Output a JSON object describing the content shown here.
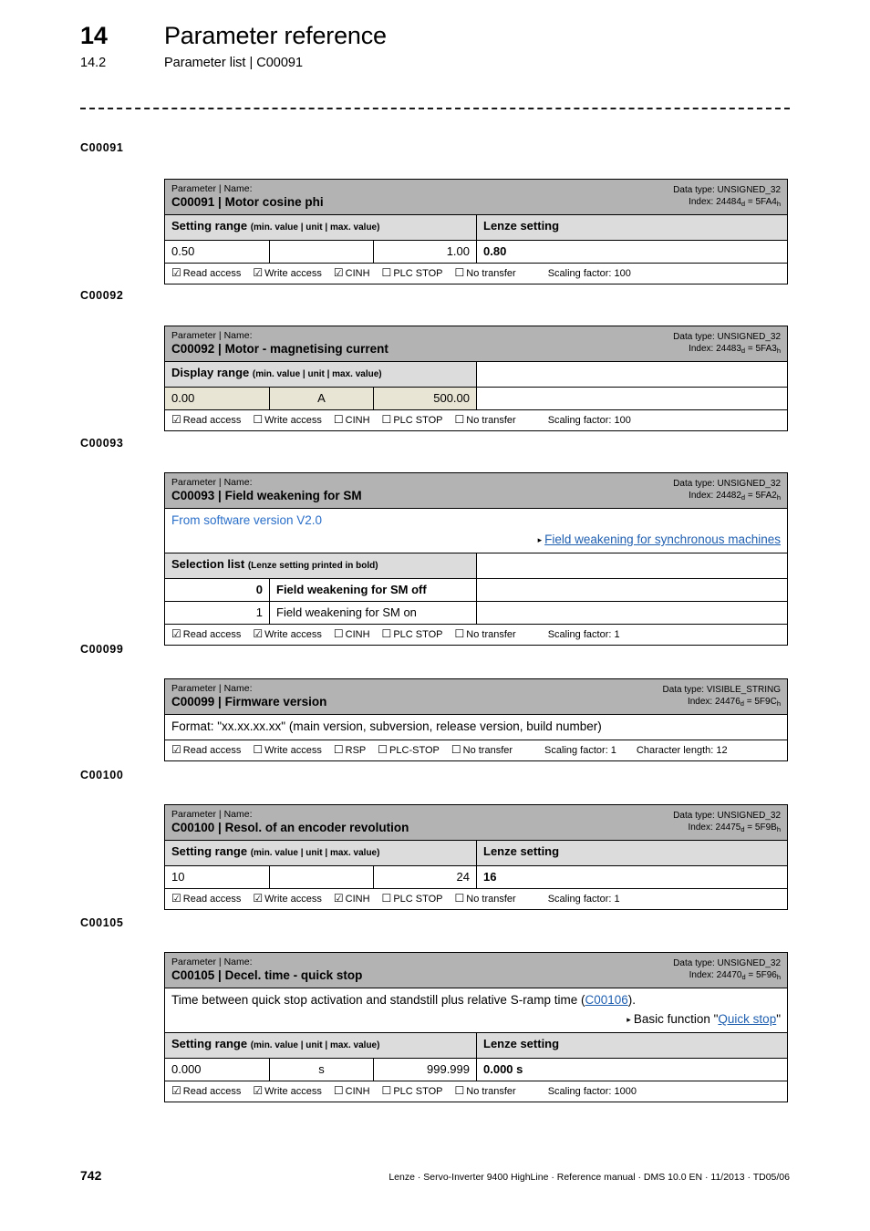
{
  "header": {
    "chapter_number": "14",
    "chapter_title": "Parameter reference",
    "section_number": "14.2",
    "section_title": "Parameter list | C00091"
  },
  "footer": {
    "page_number": "742",
    "text": "Lenze · Servo-Inverter 9400 HighLine · Reference manual · DMS 10.0 EN · 11/2013 · TD05/06"
  },
  "labels": {
    "param_name_caption": "Parameter | Name:",
    "setting_range": "Setting range",
    "display_range": "Display range",
    "range_paren": "(min. value | unit | max. value)",
    "selection_list": "Selection list",
    "selection_paren": "(Lenze setting printed in bold)",
    "lenze_setting": "Lenze setting",
    "checked": "☑",
    "unchecked": "☐",
    "triangle": "▸"
  },
  "blocks": [
    {
      "margin_label": "C00091",
      "title": "C00091 | Motor cosine phi",
      "data_type": "Data type: UNSIGNED_32",
      "index_prefix": "Index: 24484",
      "index_sub_d": "d",
      "index_mid": " = 5FA4",
      "index_sub_h": "h",
      "range_header": "Setting range",
      "range_paren": "(min. value | unit | max. value)",
      "has_lenze_column": true,
      "lenze_header": "Lenze setting",
      "readonly": false,
      "min_value": "0.50",
      "unit": "",
      "max_value": "1.00",
      "lenze_value": "0.80",
      "access": [
        {
          "label": "Read access",
          "checked": true
        },
        {
          "label": "Write access",
          "checked": true
        },
        {
          "label": "CINH",
          "checked": true
        },
        {
          "label": "PLC STOP",
          "checked": false
        },
        {
          "label": "No transfer",
          "checked": false
        }
      ],
      "scaling": "Scaling factor: 100",
      "extra": ""
    },
    {
      "margin_label": "C00092",
      "title": "C00092 | Motor - magnetising current",
      "data_type": "Data type: UNSIGNED_32",
      "index_prefix": "Index: 24483",
      "index_sub_d": "d",
      "index_mid": " = 5FA3",
      "index_sub_h": "h",
      "range_header": "Display range",
      "range_paren": "(min. value | unit | max. value)",
      "has_lenze_column": false,
      "lenze_header": "",
      "readonly": true,
      "min_value": "0.00",
      "unit": "A",
      "max_value": "500.00",
      "lenze_value": "",
      "access": [
        {
          "label": "Read access",
          "checked": true
        },
        {
          "label": "Write access",
          "checked": false
        },
        {
          "label": "CINH",
          "checked": false
        },
        {
          "label": "PLC STOP",
          "checked": false
        },
        {
          "label": "No transfer",
          "checked": false
        }
      ],
      "scaling": "Scaling factor: 100",
      "extra": ""
    },
    {
      "margin_label": "C00093",
      "title": "C00093 | Field weakening for SM",
      "data_type": "Data type: UNSIGNED_32",
      "index_prefix": "Index: 24482",
      "index_sub_d": "d",
      "index_mid": " = 5FA2",
      "index_sub_h": "h",
      "note_blue": "From software version V2.0",
      "note_link": "Field weakening for synchronous machines",
      "selection_header": "Selection list",
      "selection_paren": "(Lenze setting printed in bold)",
      "selection_rows": [
        {
          "code": "0",
          "text": "Field weakening for SM off",
          "bold": true
        },
        {
          "code": "1",
          "text": "Field weakening for SM on",
          "bold": false
        }
      ],
      "access": [
        {
          "label": "Read access",
          "checked": true
        },
        {
          "label": "Write access",
          "checked": true
        },
        {
          "label": "CINH",
          "checked": false
        },
        {
          "label": "PLC STOP",
          "checked": false
        },
        {
          "label": "No transfer",
          "checked": false
        }
      ],
      "scaling": "Scaling factor: 1",
      "extra": ""
    },
    {
      "margin_label": "C00099",
      "title": "C00099 | Firmware version",
      "data_type": "Data type: VISIBLE_STRING",
      "index_prefix": "Index: 24476",
      "index_sub_d": "d",
      "index_mid": " = 5F9C",
      "index_sub_h": "h",
      "format_text": "Format: \"xx.xx.xx.xx\" (main version, subversion, release version, build number)",
      "access": [
        {
          "label": "Read access",
          "checked": true
        },
        {
          "label": "Write access",
          "checked": false
        },
        {
          "label": "RSP",
          "checked": false
        },
        {
          "label": "PLC-STOP",
          "checked": false
        },
        {
          "label": "No transfer",
          "checked": false
        }
      ],
      "scaling": "Scaling factor: 1",
      "extra": "Character length: 12"
    },
    {
      "margin_label": "C00100",
      "title": "C00100 | Resol. of an encoder revolution",
      "data_type": "Data type: UNSIGNED_32",
      "index_prefix": "Index: 24475",
      "index_sub_d": "d",
      "index_mid": " = 5F9B",
      "index_sub_h": "h",
      "range_header": "Setting range",
      "range_paren": "(min. value | unit | max. value)",
      "has_lenze_column": true,
      "lenze_header": "Lenze setting",
      "readonly": false,
      "min_value": "10",
      "unit": "",
      "max_value": "24",
      "lenze_value": "16",
      "access": [
        {
          "label": "Read access",
          "checked": true
        },
        {
          "label": "Write access",
          "checked": true
        },
        {
          "label": "CINH",
          "checked": true
        },
        {
          "label": "PLC STOP",
          "checked": false
        },
        {
          "label": "No transfer",
          "checked": false
        }
      ],
      "scaling": "Scaling factor: 1",
      "extra": ""
    },
    {
      "margin_label": "C00105",
      "title": "C00105 | Decel. time - quick stop",
      "data_type": "Data type: UNSIGNED_32",
      "index_prefix": "Index: 24470",
      "index_sub_d": "d",
      "index_mid": " = 5F96",
      "index_sub_h": "h",
      "desc_pre": "Time between quick stop activation and standstill plus relative S-ramp time (",
      "desc_link": "C00106",
      "desc_post": ").",
      "desc_link2_pre": "Basic function \"",
      "desc_link2": "Quick stop",
      "desc_link2_post": "\"",
      "range_header": "Setting range",
      "range_paren": "(min. value | unit | max. value)",
      "has_lenze_column": true,
      "lenze_header": "Lenze setting",
      "readonly": false,
      "min_value": "0.000",
      "unit": "s",
      "max_value": "999.999",
      "lenze_value": "0.000 s",
      "access": [
        {
          "label": "Read access",
          "checked": true
        },
        {
          "label": "Write access",
          "checked": true
        },
        {
          "label": "CINH",
          "checked": false
        },
        {
          "label": "PLC STOP",
          "checked": false
        },
        {
          "label": "No transfer",
          "checked": false
        }
      ],
      "scaling": "Scaling factor: 1000",
      "extra": ""
    }
  ]
}
